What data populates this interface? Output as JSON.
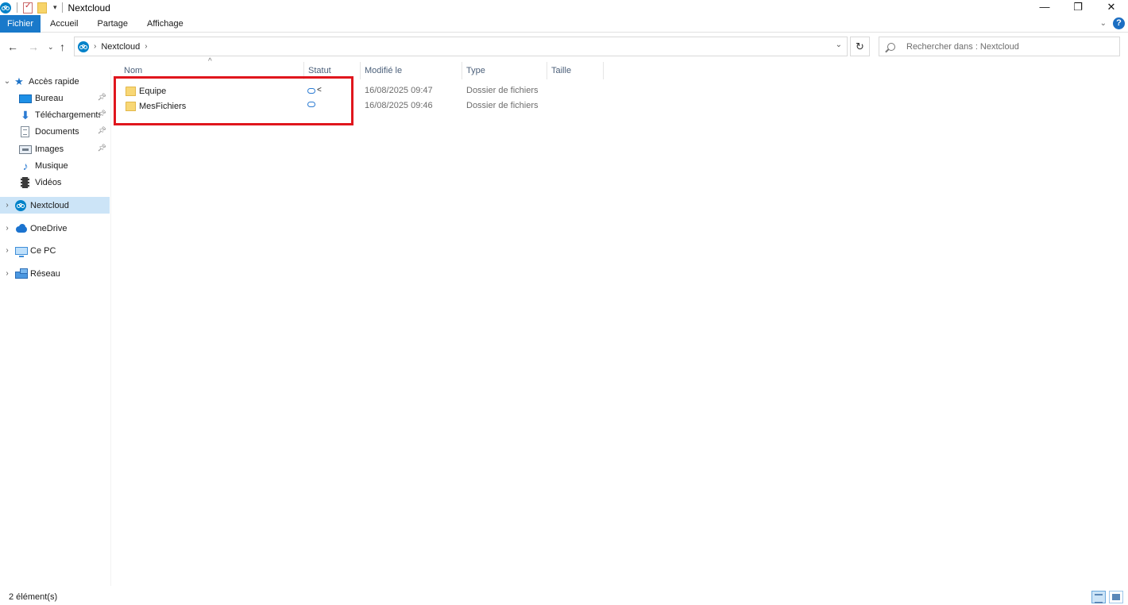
{
  "window": {
    "title": "Nextcloud",
    "controls": {
      "minimize": "—",
      "restore": "❐",
      "close": "✕"
    }
  },
  "ribbon": {
    "tabs": [
      {
        "label": "Fichier",
        "active": true
      },
      {
        "label": "Accueil",
        "active": false
      },
      {
        "label": "Partage",
        "active": false
      },
      {
        "label": "Affichage",
        "active": false
      }
    ],
    "help": "?"
  },
  "address": {
    "crumbs": [
      "Nextcloud"
    ],
    "search_placeholder": "Rechercher dans : Nextcloud"
  },
  "sidebar": {
    "quick_access": {
      "label": "Accès rapide",
      "icon": "star-icon"
    },
    "items": [
      {
        "label": "Bureau",
        "icon": "desktop-icon",
        "pinned": true
      },
      {
        "label": "Téléchargements",
        "icon": "download-icon",
        "pinned": true
      },
      {
        "label": "Documents",
        "icon": "document-icon",
        "pinned": true
      },
      {
        "label": "Images",
        "icon": "pictures-icon",
        "pinned": true
      },
      {
        "label": "Musique",
        "icon": "music-icon",
        "pinned": false
      },
      {
        "label": "Vidéos",
        "icon": "video-icon",
        "pinned": false
      }
    ],
    "roots": [
      {
        "label": "Nextcloud",
        "icon": "nextcloud-icon",
        "selected": true
      },
      {
        "label": "OneDrive",
        "icon": "onedrive-icon",
        "selected": false
      },
      {
        "label": "Ce PC",
        "icon": "computer-icon",
        "selected": false
      },
      {
        "label": "Réseau",
        "icon": "network-icon",
        "selected": false
      }
    ]
  },
  "columns": {
    "name": "Nom",
    "status": "Statut",
    "modified": "Modifié le",
    "type": "Type",
    "size": "Taille"
  },
  "files": [
    {
      "name": "Equipe",
      "status": [
        "cloud-icon",
        "share-icon"
      ],
      "modified": "16/08/2025 09:47",
      "type": "Dossier de fichiers"
    },
    {
      "name": "MesFichiers",
      "status": [
        "cloud-icon"
      ],
      "modified": "16/08/2025 09:46",
      "type": "Dossier de fichiers"
    }
  ],
  "statusbar": {
    "count": "2 élément(s)"
  },
  "colors": {
    "accent": "#1979ca",
    "selection": "#cce4f7",
    "highlight": "#e0161d",
    "nextcloud": "#0082c9"
  }
}
